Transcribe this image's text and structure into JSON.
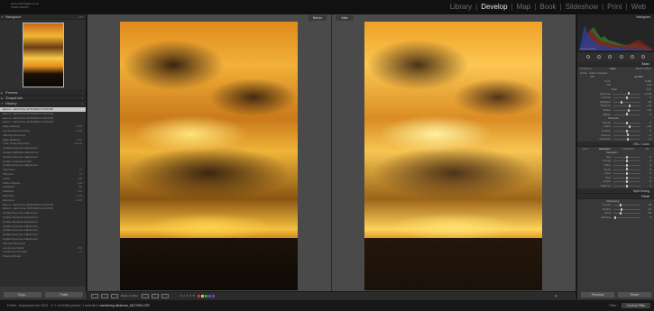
{
  "app": {
    "logo_line1": "www.vividimages.co.uk",
    "logo_line2": "VIVID LIGHTS",
    "modules": [
      "Library",
      "Develop",
      "Map",
      "Book",
      "Slideshow",
      "Print",
      "Web"
    ],
    "active_module": "Develop"
  },
  "left_panel": {
    "navigator": {
      "title": "Navigator",
      "zoom": "FIT"
    },
    "presets": "Presets",
    "snapshots": "Snapshots",
    "history": {
      "title": "History",
      "items": [
        {
          "label": "Export - Hard Drive (07/03/2014 15:08:48)",
          "value": ""
        },
        {
          "label": "Export - Hard Drive (07/03/2014 14:04:07)",
          "value": ""
        },
        {
          "label": "Export - Hard Drive (07/03/2014 14:01:16)",
          "value": ""
        },
        {
          "label": "Export - Hard Drive (07/03/2014 14:00:02)",
          "value": ""
        },
        {
          "label": "Edge Masking",
          "value": "+6   60"
        },
        {
          "label": "Luminance Smoothing",
          "value": "+4   40"
        },
        {
          "label": "Add Spot Removal",
          "value": ""
        },
        {
          "label": "Edge Masking",
          "value": "-2   62"
        },
        {
          "label": "Color Noise Reduction",
          "value": "+25  25"
        },
        {
          "label": "Update Exposure Adjustment",
          "value": ""
        },
        {
          "label": "Update Highlights Adjustment",
          "value": ""
        },
        {
          "label": "Update Exposure Adjustment",
          "value": ""
        },
        {
          "label": "Update Graduated Filter",
          "value": ""
        },
        {
          "label": "Update Exposure Adjustment",
          "value": ""
        },
        {
          "label": "Saturation",
          "value": "+4"
        },
        {
          "label": "Vibrance",
          "value": "+6"
        },
        {
          "label": "Clarity",
          "value": "+18"
        },
        {
          "label": "White Clipping",
          "value": "+10"
        },
        {
          "label": "Highlights",
          "value": "-40"
        },
        {
          "label": "Shadows",
          "value": "+22"
        },
        {
          "label": "Exposure",
          "value": "-0.15"
        },
        {
          "label": "Exposure",
          "value": "+0.25"
        },
        {
          "label": "Export - Hard Drive (06/03/2014 22:09:34)",
          "value": ""
        },
        {
          "label": "Export - Hard Drive (06/03/2014 22:04:07)",
          "value": ""
        },
        {
          "label": "Update Exposure Adjustment",
          "value": ""
        },
        {
          "label": "Update Shadows Adjustment",
          "value": ""
        },
        {
          "label": "Update Shadows Adjustment",
          "value": ""
        },
        {
          "label": "Update Exposure Adjustment",
          "value": ""
        },
        {
          "label": "Update Exposure Adjustment",
          "value": ""
        },
        {
          "label": "Update Exposure Adjustment",
          "value": ""
        },
        {
          "label": "Update Exposure Adjustment",
          "value": ""
        },
        {
          "label": "Add Spot Removal",
          "value": ""
        },
        {
          "label": "Luminance Detail",
          "value": "+50"
        },
        {
          "label": "Luminance Contrast",
          "value": "+4"
        },
        {
          "label": "Sharpen Detail",
          "value": ""
        }
      ]
    },
    "copy_button": "Copy...",
    "paste_button": "Paste"
  },
  "center": {
    "before_label": "Before",
    "after_label": "After"
  },
  "toolbar": {
    "before_after": "Before & After :",
    "stars": "★ ★ ★ ★ ★",
    "label_colors": [
      "#c33",
      "#cc3",
      "#3a3",
      "#36c",
      "#939"
    ]
  },
  "right_panel": {
    "histogram": "Histogram",
    "histogram_info": "Original Photo",
    "basic": "Basic",
    "treatment_label": "Treatment :",
    "treatment_color": "Color",
    "treatment_bw": "Black & White",
    "profile": "Profile : Adobe Standard",
    "wb_label": "WB :",
    "wb_value": "As Shot",
    "tone_label": "Tone",
    "tone_auto": "Auto",
    "rows_top": [
      {
        "label": "Temp",
        "value": "5,450"
      },
      {
        "label": "Tint",
        "value": "+ 15"
      }
    ],
    "rows_tone": [
      {
        "label": "Exposure",
        "value": "+ 0.25",
        "pos": 0.55
      },
      {
        "label": "Contrast",
        "value": "0",
        "pos": 0.5
      },
      {
        "label": "Highlights",
        "value": "- 40",
        "pos": 0.3
      },
      {
        "label": "Shadows",
        "value": "+ 22",
        "pos": 0.61
      },
      {
        "label": "Whites",
        "value": "+ 10",
        "pos": 0.55
      },
      {
        "label": "Blacks",
        "value": "0",
        "pos": 0.5
      }
    ],
    "presence_label": "Presence",
    "rows_presence": [
      {
        "label": "Texture",
        "value": "0",
        "pos": 0.5
      },
      {
        "label": "Clarity",
        "value": "+ 18",
        "pos": 0.59
      },
      {
        "label": "Dehaze",
        "value": "0",
        "pos": 0.5
      },
      {
        "label": "Vibrance",
        "value": "+ 6",
        "pos": 0.53
      },
      {
        "label": "Saturation",
        "value": "+ 4",
        "pos": 0.52
      }
    ],
    "hsl": "HSL / Color",
    "hsl_tabs": [
      "Hue",
      "Saturation",
      "Luminance",
      "All"
    ],
    "saturation_label": "Saturation",
    "rows_hsl": [
      {
        "label": "Red",
        "value": "0",
        "pos": 0.5
      },
      {
        "label": "Orange",
        "value": "0",
        "pos": 0.5
      },
      {
        "label": "Yellow",
        "value": "0",
        "pos": 0.5
      },
      {
        "label": "Green",
        "value": "0",
        "pos": 0.5
      },
      {
        "label": "Aqua",
        "value": "0",
        "pos": 0.5
      },
      {
        "label": "Blue",
        "value": "0",
        "pos": 0.5
      },
      {
        "label": "Purple",
        "value": "0",
        "pos": 0.5
      },
      {
        "label": "Magenta",
        "value": "0",
        "pos": 0.5
      }
    ],
    "split_toning": "Split Toning",
    "detail": "Detail",
    "sharpening_label": "Sharpening",
    "rows_sharpen": [
      {
        "label": "Amount",
        "value": "40",
        "pos": 0.27
      },
      {
        "label": "Radius",
        "value": "1.0",
        "pos": 0.3
      },
      {
        "label": "Detail",
        "value": "25",
        "pos": 0.25
      },
      {
        "label": "Masking",
        "value": "0",
        "pos": 0.05
      }
    ],
    "previous_button": "Previous",
    "reset_button": "Reset"
  },
  "filmstrip": {
    "info": "Folder : Ampersica Dec 2013",
    "count": "9 / 1 of 11484 photos / 1 selected /",
    "filename": "wandering albatross_5D17053.CR2",
    "filter_label": "Filter :",
    "filter_value": "Custom Filter"
  }
}
